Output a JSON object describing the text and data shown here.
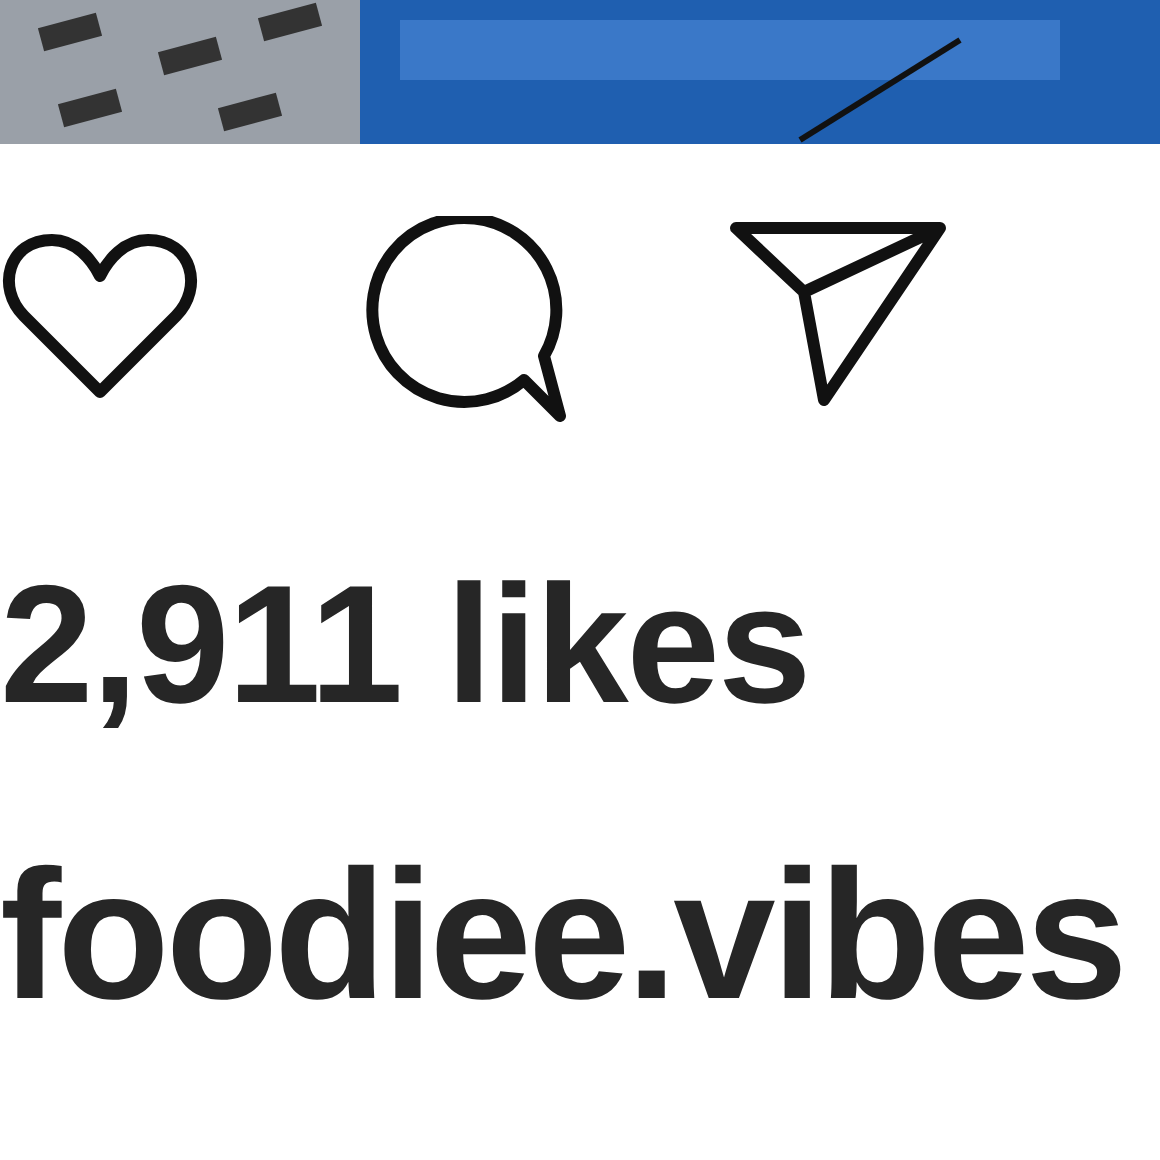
{
  "post": {
    "likes": "2,911 likes",
    "username": "foodiee.vibes"
  }
}
